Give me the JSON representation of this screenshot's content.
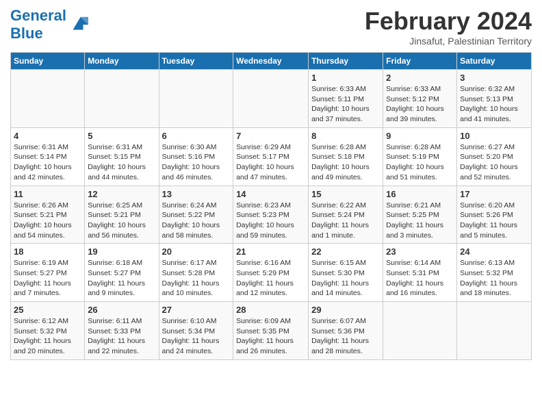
{
  "header": {
    "logo_general": "General",
    "logo_blue": "Blue",
    "month_title": "February 2024",
    "location": "Jinsafut, Palestinian Territory"
  },
  "columns": [
    "Sunday",
    "Monday",
    "Tuesday",
    "Wednesday",
    "Thursday",
    "Friday",
    "Saturday"
  ],
  "weeks": [
    {
      "days": [
        {
          "num": "",
          "info": ""
        },
        {
          "num": "",
          "info": ""
        },
        {
          "num": "",
          "info": ""
        },
        {
          "num": "",
          "info": ""
        },
        {
          "num": "1",
          "info": "Sunrise: 6:33 AM\nSunset: 5:11 PM\nDaylight: 10 hours and 37 minutes."
        },
        {
          "num": "2",
          "info": "Sunrise: 6:33 AM\nSunset: 5:12 PM\nDaylight: 10 hours and 39 minutes."
        },
        {
          "num": "3",
          "info": "Sunrise: 6:32 AM\nSunset: 5:13 PM\nDaylight: 10 hours and 41 minutes."
        }
      ]
    },
    {
      "days": [
        {
          "num": "4",
          "info": "Sunrise: 6:31 AM\nSunset: 5:14 PM\nDaylight: 10 hours and 42 minutes."
        },
        {
          "num": "5",
          "info": "Sunrise: 6:31 AM\nSunset: 5:15 PM\nDaylight: 10 hours and 44 minutes."
        },
        {
          "num": "6",
          "info": "Sunrise: 6:30 AM\nSunset: 5:16 PM\nDaylight: 10 hours and 46 minutes."
        },
        {
          "num": "7",
          "info": "Sunrise: 6:29 AM\nSunset: 5:17 PM\nDaylight: 10 hours and 47 minutes."
        },
        {
          "num": "8",
          "info": "Sunrise: 6:28 AM\nSunset: 5:18 PM\nDaylight: 10 hours and 49 minutes."
        },
        {
          "num": "9",
          "info": "Sunrise: 6:28 AM\nSunset: 5:19 PM\nDaylight: 10 hours and 51 minutes."
        },
        {
          "num": "10",
          "info": "Sunrise: 6:27 AM\nSunset: 5:20 PM\nDaylight: 10 hours and 52 minutes."
        }
      ]
    },
    {
      "days": [
        {
          "num": "11",
          "info": "Sunrise: 6:26 AM\nSunset: 5:21 PM\nDaylight: 10 hours and 54 minutes."
        },
        {
          "num": "12",
          "info": "Sunrise: 6:25 AM\nSunset: 5:21 PM\nDaylight: 10 hours and 56 minutes."
        },
        {
          "num": "13",
          "info": "Sunrise: 6:24 AM\nSunset: 5:22 PM\nDaylight: 10 hours and 58 minutes."
        },
        {
          "num": "14",
          "info": "Sunrise: 6:23 AM\nSunset: 5:23 PM\nDaylight: 10 hours and 59 minutes."
        },
        {
          "num": "15",
          "info": "Sunrise: 6:22 AM\nSunset: 5:24 PM\nDaylight: 11 hours and 1 minute."
        },
        {
          "num": "16",
          "info": "Sunrise: 6:21 AM\nSunset: 5:25 PM\nDaylight: 11 hours and 3 minutes."
        },
        {
          "num": "17",
          "info": "Sunrise: 6:20 AM\nSunset: 5:26 PM\nDaylight: 11 hours and 5 minutes."
        }
      ]
    },
    {
      "days": [
        {
          "num": "18",
          "info": "Sunrise: 6:19 AM\nSunset: 5:27 PM\nDaylight: 11 hours and 7 minutes."
        },
        {
          "num": "19",
          "info": "Sunrise: 6:18 AM\nSunset: 5:27 PM\nDaylight: 11 hours and 9 minutes."
        },
        {
          "num": "20",
          "info": "Sunrise: 6:17 AM\nSunset: 5:28 PM\nDaylight: 11 hours and 10 minutes."
        },
        {
          "num": "21",
          "info": "Sunrise: 6:16 AM\nSunset: 5:29 PM\nDaylight: 11 hours and 12 minutes."
        },
        {
          "num": "22",
          "info": "Sunrise: 6:15 AM\nSunset: 5:30 PM\nDaylight: 11 hours and 14 minutes."
        },
        {
          "num": "23",
          "info": "Sunrise: 6:14 AM\nSunset: 5:31 PM\nDaylight: 11 hours and 16 minutes."
        },
        {
          "num": "24",
          "info": "Sunrise: 6:13 AM\nSunset: 5:32 PM\nDaylight: 11 hours and 18 minutes."
        }
      ]
    },
    {
      "days": [
        {
          "num": "25",
          "info": "Sunrise: 6:12 AM\nSunset: 5:32 PM\nDaylight: 11 hours and 20 minutes."
        },
        {
          "num": "26",
          "info": "Sunrise: 6:11 AM\nSunset: 5:33 PM\nDaylight: 11 hours and 22 minutes."
        },
        {
          "num": "27",
          "info": "Sunrise: 6:10 AM\nSunset: 5:34 PM\nDaylight: 11 hours and 24 minutes."
        },
        {
          "num": "28",
          "info": "Sunrise: 6:09 AM\nSunset: 5:35 PM\nDaylight: 11 hours and 26 minutes."
        },
        {
          "num": "29",
          "info": "Sunrise: 6:07 AM\nSunset: 5:36 PM\nDaylight: 11 hours and 28 minutes."
        },
        {
          "num": "",
          "info": ""
        },
        {
          "num": "",
          "info": ""
        }
      ]
    }
  ]
}
